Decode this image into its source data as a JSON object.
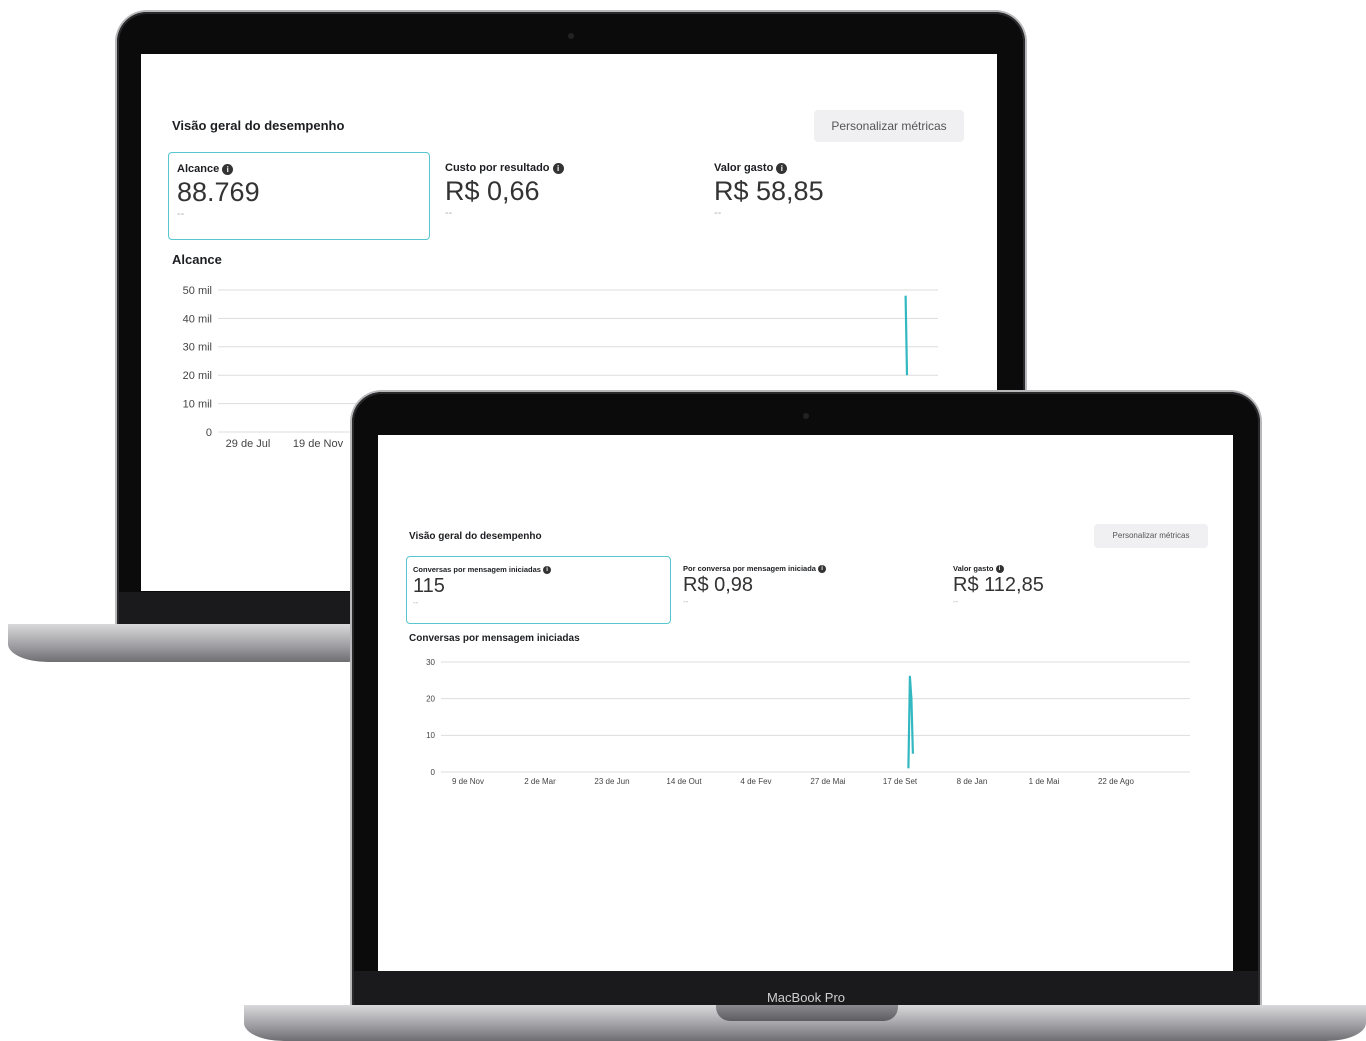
{
  "back_laptop": {
    "title": "Visão geral do desempenho",
    "customize_button": "Personalizar métricas",
    "metrics": [
      {
        "label": "Alcance",
        "value": "88.769",
        "delta": "--"
      },
      {
        "label": "Custo por resultado",
        "value": "R$ 0,66",
        "delta": "--"
      },
      {
        "label": "Valor gasto",
        "value": "R$ 58,85",
        "delta": "--"
      }
    ],
    "chart_data": {
      "type": "line",
      "title": "Alcance",
      "y_ticks": [
        "50 mil",
        "40 mil",
        "30 mil",
        "20 mil",
        "10 mil",
        "0"
      ],
      "x_ticks": [
        "29 de Jul",
        "19 de Nov"
      ],
      "ylim": [
        0,
        50000
      ],
      "series": [
        {
          "x": [
            0.955,
            0.957
          ],
          "values": [
            48000,
            20000
          ]
        }
      ],
      "color": "#33b8c2"
    }
  },
  "front_laptop": {
    "title": "Visão geral do desempenho",
    "customize_button": "Personalizar métricas",
    "brand": "MacBook Pro",
    "metrics": [
      {
        "label": "Conversas por mensagem iniciadas",
        "value": "115",
        "delta": "--"
      },
      {
        "label": "Por conversa por mensagem iniciada",
        "value": "R$ 0,98",
        "delta": "--"
      },
      {
        "label": "Valor gasto",
        "value": "R$ 112,85",
        "delta": "--"
      }
    ],
    "chart_data": {
      "type": "line",
      "title": "Conversas por mensagem iniciadas",
      "y_ticks": [
        "30",
        "20",
        "10",
        "0"
      ],
      "x_ticks": [
        "9 de Nov",
        "2 de Mar",
        "23 de Jun",
        "14 de Out",
        "4 de Fev",
        "27 de Mai",
        "17 de Set",
        "8 de Jan",
        "1 de Mai",
        "22 de Ago"
      ],
      "ylim": [
        0,
        30
      ],
      "series": [
        {
          "x": [
            0.624,
            0.626,
            0.628,
            0.63
          ],
          "values": [
            1,
            26,
            20,
            5
          ]
        }
      ],
      "color": "#33b8c2"
    }
  }
}
